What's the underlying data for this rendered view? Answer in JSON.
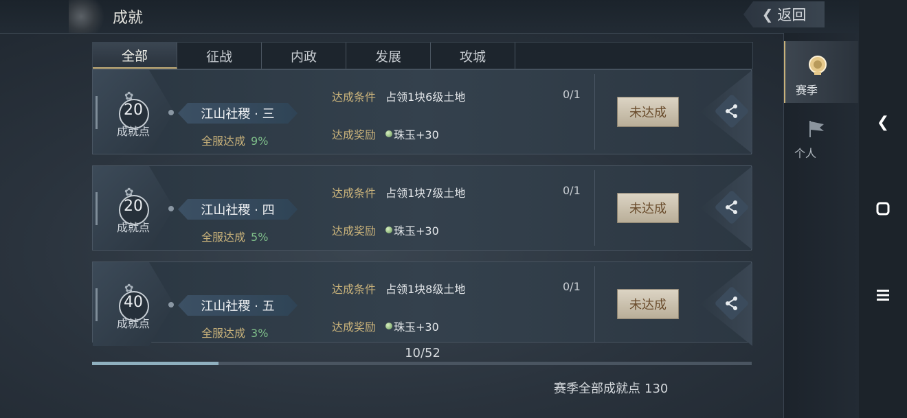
{
  "header": {
    "title": "成就",
    "back_label": "返回"
  },
  "tabs": [
    {
      "label": "全部",
      "active": true
    },
    {
      "label": "征战",
      "active": false
    },
    {
      "label": "内政",
      "active": false
    },
    {
      "label": "发展",
      "active": false
    },
    {
      "label": "攻城",
      "active": false
    }
  ],
  "achievements": [
    {
      "points": "20",
      "points_label": "成就点",
      "name": "江山社稷 · 三",
      "server_rate_label": "全服达成",
      "server_rate": "9%",
      "condition_label": "达成条件",
      "condition": "占领1块6级土地",
      "progress": "0/1",
      "reward_label": "达成奖励",
      "reward": "珠玉+30",
      "status": "未达成"
    },
    {
      "points": "20",
      "points_label": "成就点",
      "name": "江山社稷 · 四",
      "server_rate_label": "全服达成",
      "server_rate": "5%",
      "condition_label": "达成条件",
      "condition": "占领1块7级土地",
      "progress": "0/1",
      "reward_label": "达成奖励",
      "reward": "珠玉+30",
      "status": "未达成"
    },
    {
      "points": "40",
      "points_label": "成就点",
      "name": "江山社稷 · 五",
      "server_rate_label": "全服达成",
      "server_rate": "3%",
      "condition_label": "达成条件",
      "condition": "占领1块8级土地",
      "progress": "0/1",
      "reward_label": "达成奖励",
      "reward": "珠玉+30",
      "status": "未达成"
    }
  ],
  "pagination": {
    "text": "10/52",
    "fraction": 0.192
  },
  "footer": {
    "total_label": "赛季全部成就点",
    "total_value": "130"
  },
  "side_tabs": [
    {
      "label": "赛季",
      "icon": "season-medal-icon",
      "active": true
    },
    {
      "label": "个人",
      "icon": "personal-flag-icon",
      "active": false
    }
  ],
  "system_nav": [
    {
      "icon": "back-chevron-icon"
    },
    {
      "icon": "home-square-icon"
    },
    {
      "icon": "menu-lines-icon"
    }
  ],
  "colors": {
    "gold": "#c9b27a",
    "green_pct": "#7fbf8a",
    "button_bg": "#dcd4c4"
  }
}
